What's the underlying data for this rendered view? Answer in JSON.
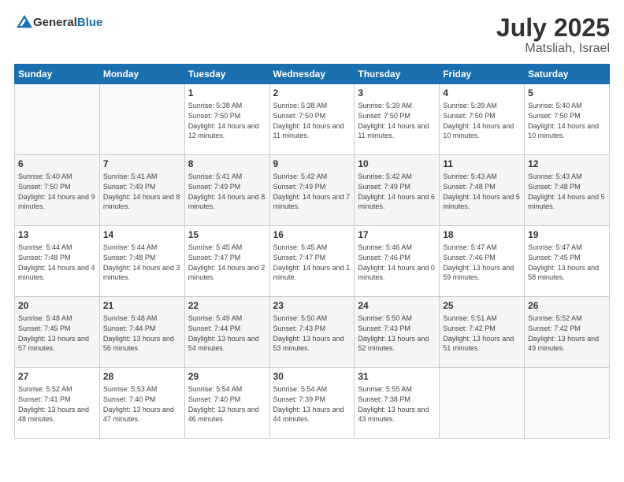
{
  "header": {
    "logo_general": "General",
    "logo_blue": "Blue",
    "month_year": "July 2025",
    "location": "Matsliah, Israel"
  },
  "weekdays": [
    "Sunday",
    "Monday",
    "Tuesday",
    "Wednesday",
    "Thursday",
    "Friday",
    "Saturday"
  ],
  "weeks": [
    [
      {
        "day": "",
        "detail": ""
      },
      {
        "day": "",
        "detail": ""
      },
      {
        "day": "1",
        "detail": "Sunrise: 5:38 AM\nSunset: 7:50 PM\nDaylight: 14 hours and 12 minutes."
      },
      {
        "day": "2",
        "detail": "Sunrise: 5:38 AM\nSunset: 7:50 PM\nDaylight: 14 hours and 11 minutes."
      },
      {
        "day": "3",
        "detail": "Sunrise: 5:39 AM\nSunset: 7:50 PM\nDaylight: 14 hours and 11 minutes."
      },
      {
        "day": "4",
        "detail": "Sunrise: 5:39 AM\nSunset: 7:50 PM\nDaylight: 14 hours and 10 minutes."
      },
      {
        "day": "5",
        "detail": "Sunrise: 5:40 AM\nSunset: 7:50 PM\nDaylight: 14 hours and 10 minutes."
      }
    ],
    [
      {
        "day": "6",
        "detail": "Sunrise: 5:40 AM\nSunset: 7:50 PM\nDaylight: 14 hours and 9 minutes."
      },
      {
        "day": "7",
        "detail": "Sunrise: 5:41 AM\nSunset: 7:49 PM\nDaylight: 14 hours and 8 minutes."
      },
      {
        "day": "8",
        "detail": "Sunrise: 5:41 AM\nSunset: 7:49 PM\nDaylight: 14 hours and 8 minutes."
      },
      {
        "day": "9",
        "detail": "Sunrise: 5:42 AM\nSunset: 7:49 PM\nDaylight: 14 hours and 7 minutes."
      },
      {
        "day": "10",
        "detail": "Sunrise: 5:42 AM\nSunset: 7:49 PM\nDaylight: 14 hours and 6 minutes."
      },
      {
        "day": "11",
        "detail": "Sunrise: 5:43 AM\nSunset: 7:48 PM\nDaylight: 14 hours and 5 minutes."
      },
      {
        "day": "12",
        "detail": "Sunrise: 5:43 AM\nSunset: 7:48 PM\nDaylight: 14 hours and 5 minutes."
      }
    ],
    [
      {
        "day": "13",
        "detail": "Sunrise: 5:44 AM\nSunset: 7:48 PM\nDaylight: 14 hours and 4 minutes."
      },
      {
        "day": "14",
        "detail": "Sunrise: 5:44 AM\nSunset: 7:48 PM\nDaylight: 14 hours and 3 minutes."
      },
      {
        "day": "15",
        "detail": "Sunrise: 5:45 AM\nSunset: 7:47 PM\nDaylight: 14 hours and 2 minutes."
      },
      {
        "day": "16",
        "detail": "Sunrise: 5:45 AM\nSunset: 7:47 PM\nDaylight: 14 hours and 1 minute."
      },
      {
        "day": "17",
        "detail": "Sunrise: 5:46 AM\nSunset: 7:46 PM\nDaylight: 14 hours and 0 minutes."
      },
      {
        "day": "18",
        "detail": "Sunrise: 5:47 AM\nSunset: 7:46 PM\nDaylight: 13 hours and 59 minutes."
      },
      {
        "day": "19",
        "detail": "Sunrise: 5:47 AM\nSunset: 7:45 PM\nDaylight: 13 hours and 58 minutes."
      }
    ],
    [
      {
        "day": "20",
        "detail": "Sunrise: 5:48 AM\nSunset: 7:45 PM\nDaylight: 13 hours and 57 minutes."
      },
      {
        "day": "21",
        "detail": "Sunrise: 5:48 AM\nSunset: 7:44 PM\nDaylight: 13 hours and 56 minutes."
      },
      {
        "day": "22",
        "detail": "Sunrise: 5:49 AM\nSunset: 7:44 PM\nDaylight: 13 hours and 54 minutes."
      },
      {
        "day": "23",
        "detail": "Sunrise: 5:50 AM\nSunset: 7:43 PM\nDaylight: 13 hours and 53 minutes."
      },
      {
        "day": "24",
        "detail": "Sunrise: 5:50 AM\nSunset: 7:43 PM\nDaylight: 13 hours and 52 minutes."
      },
      {
        "day": "25",
        "detail": "Sunrise: 5:51 AM\nSunset: 7:42 PM\nDaylight: 13 hours and 51 minutes."
      },
      {
        "day": "26",
        "detail": "Sunrise: 5:52 AM\nSunset: 7:42 PM\nDaylight: 13 hours and 49 minutes."
      }
    ],
    [
      {
        "day": "27",
        "detail": "Sunrise: 5:52 AM\nSunset: 7:41 PM\nDaylight: 13 hours and 48 minutes."
      },
      {
        "day": "28",
        "detail": "Sunrise: 5:53 AM\nSunset: 7:40 PM\nDaylight: 13 hours and 47 minutes."
      },
      {
        "day": "29",
        "detail": "Sunrise: 5:54 AM\nSunset: 7:40 PM\nDaylight: 13 hours and 46 minutes."
      },
      {
        "day": "30",
        "detail": "Sunrise: 5:54 AM\nSunset: 7:39 PM\nDaylight: 13 hours and 44 minutes."
      },
      {
        "day": "31",
        "detail": "Sunrise: 5:55 AM\nSunset: 7:38 PM\nDaylight: 13 hours and 43 minutes."
      },
      {
        "day": "",
        "detail": ""
      },
      {
        "day": "",
        "detail": ""
      }
    ]
  ]
}
